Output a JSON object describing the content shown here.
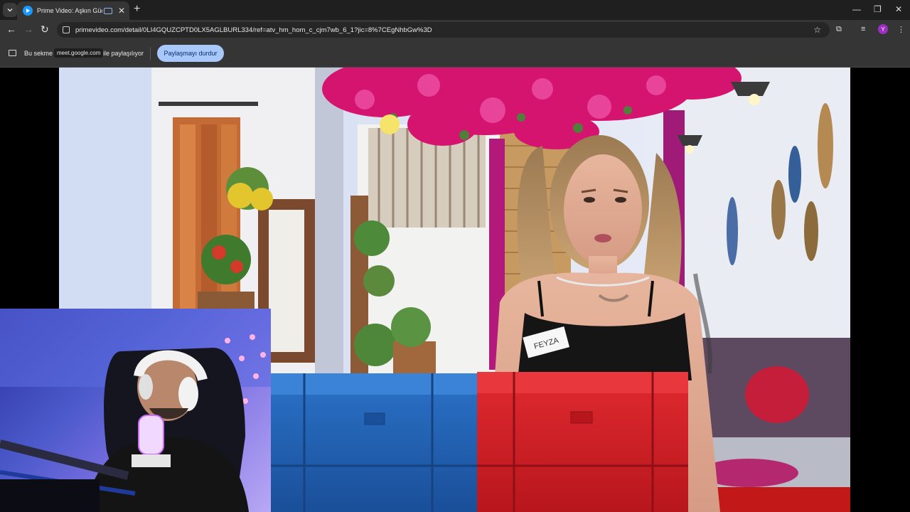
{
  "tab": {
    "title": "Prime Video: Aşkın Gücü"
  },
  "omnibox": {
    "url": "primevideo.com/detail/0LI4GQUZCPTD0LX5AGLBURL334/ref=atv_hm_hom_c_cjm7wb_6_1?jic=8%7CEgNhbGw%3D"
  },
  "profile": {
    "initial": "Y"
  },
  "sharebar": {
    "text_before": "Bu sekme",
    "domain": "meet.google.com",
    "text_after": "ile paylaşılıyor",
    "stop_label": "Paylaşmayı durdur"
  },
  "video": {
    "name_tag": "FEYZA"
  },
  "colors": {
    "accent": "#a8c7fa",
    "tab_bg": "#353535",
    "frame_bg": "#1f1f1f",
    "blue_chest": "#1e5fb3",
    "red_chest": "#d71f26"
  }
}
